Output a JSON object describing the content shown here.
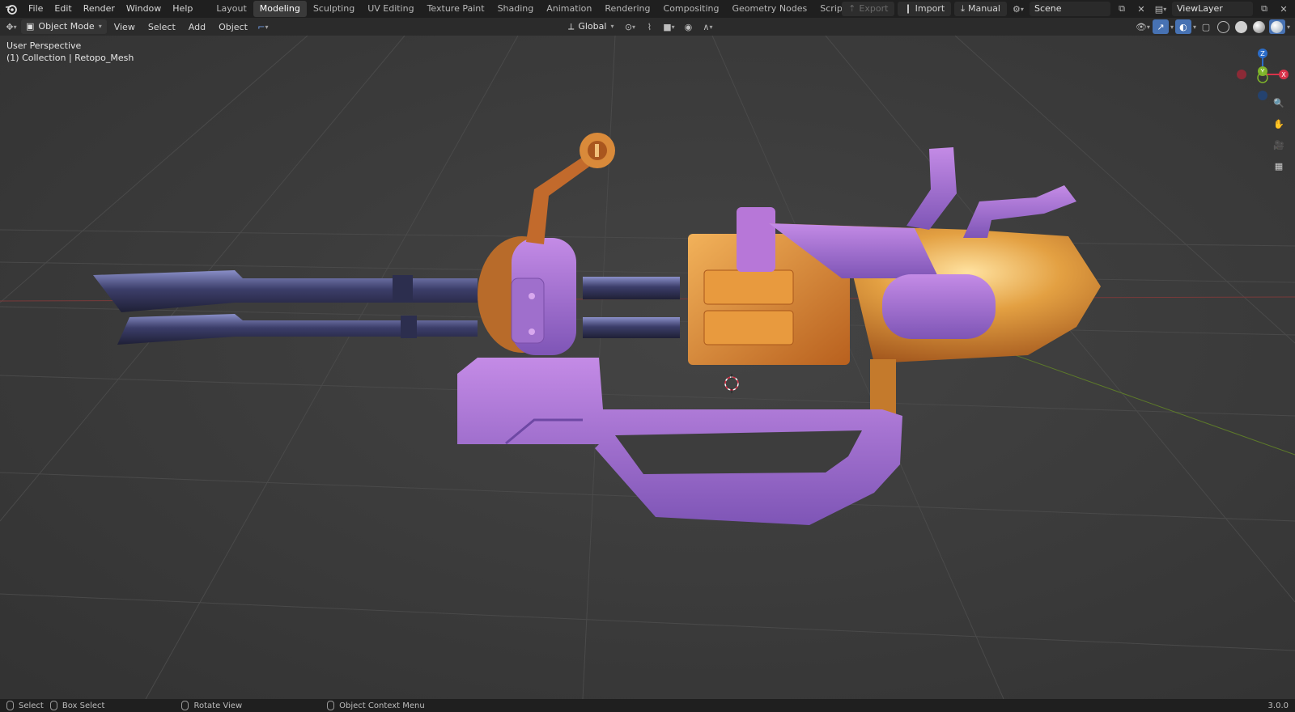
{
  "topbar": {
    "menus": [
      "File",
      "Edit",
      "Render",
      "Window",
      "Help"
    ],
    "workspaces": [
      "Layout",
      "Modeling",
      "Sculpting",
      "UV Editing",
      "Texture Paint",
      "Shading",
      "Animation",
      "Rendering",
      "Compositing",
      "Geometry Nodes",
      "Scripting"
    ],
    "active_workspace": "Modeling",
    "export_label": "Export",
    "import_label": "Import",
    "manual_label": "Manual",
    "scene_name": "Scene",
    "view_layer_name": "ViewLayer"
  },
  "header": {
    "mode": "Object Mode",
    "menus": [
      "View",
      "Select",
      "Add",
      "Object"
    ],
    "orientation": "Global"
  },
  "viewport": {
    "perspective_label": "User Perspective",
    "collection_label": "(1) Collection | Retopo_Mesh",
    "gizmo_axes": [
      "Z",
      "Y",
      "X"
    ]
  },
  "statusbar": {
    "select": "Select",
    "box_select": "Box Select",
    "rotate_view": "Rotate View",
    "context_menu": "Object Context Menu",
    "version": "3.0.0"
  },
  "colors": {
    "accent": "#4772b3",
    "axis_x": "#d8334a",
    "axis_y": "#7fb52a",
    "axis_z": "#2b6cc8",
    "model_purple": "#b873d6",
    "model_orange": "#d9842d"
  }
}
